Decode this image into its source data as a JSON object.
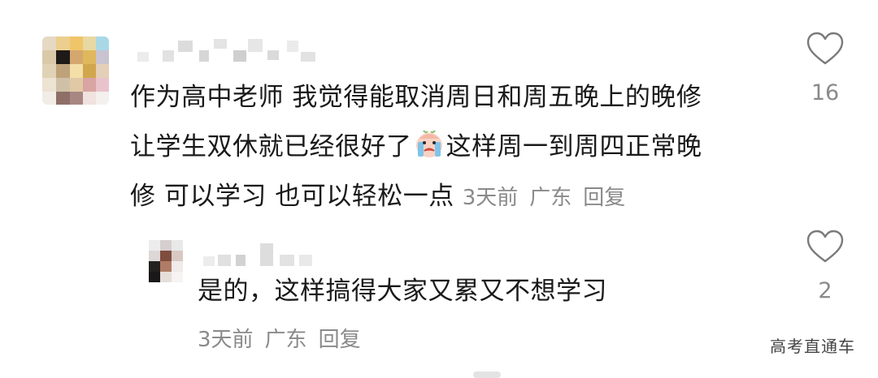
{
  "comment": {
    "text_lines": [
      "作为高中老师 我觉得能取消周日和周五晚上的晚修",
      "让学生双休就已经很好了",
      "这样周一到周四正常晚",
      "修 可以学习 也可以轻松一点"
    ],
    "emoji": "crying-face-emoji",
    "time": "3天前",
    "location": "广东",
    "reply_label": "回复",
    "likes": "16"
  },
  "reply": {
    "text": "是的，这样搞得大家又累又不想学习",
    "time": "3天前",
    "location": "广东",
    "reply_label": "回复",
    "likes": "2"
  },
  "watermark": "高考直通车",
  "colors": {
    "text": "#1a1a1a",
    "meta": "#8a8a8a",
    "heart_outline": "#7a7a7a",
    "background": "#ffffff"
  },
  "icons": {
    "like": "heart-outline-icon"
  }
}
